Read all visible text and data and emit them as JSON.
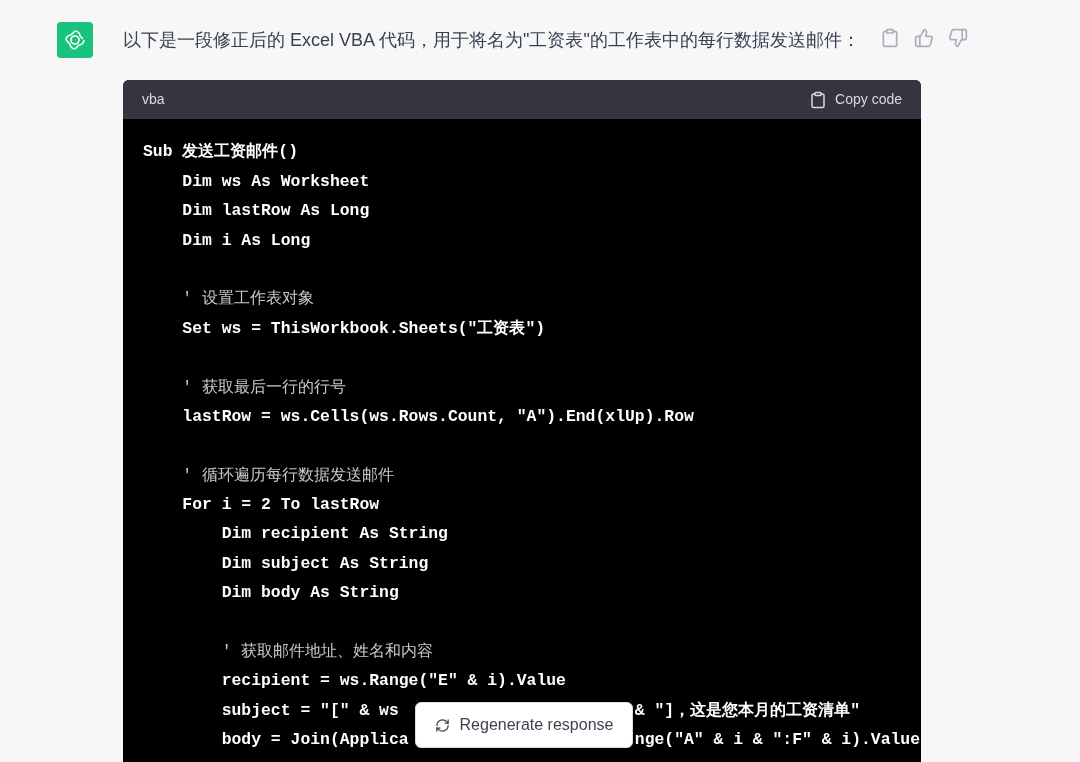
{
  "message": {
    "text": "以下是一段修正后的 Excel VBA 代码，用于将名为\"工资表\"的工作表中的每行数据发送邮件："
  },
  "code_block": {
    "language": "vba",
    "copy_label": "Copy code",
    "lines": [
      {
        "kind": "code",
        "text": "Sub 发送工资邮件()"
      },
      {
        "kind": "code",
        "text": "    Dim ws As Worksheet"
      },
      {
        "kind": "code",
        "text": "    Dim lastRow As Long"
      },
      {
        "kind": "code",
        "text": "    Dim i As Long"
      },
      {
        "kind": "blank"
      },
      {
        "kind": "comment",
        "text": "    ' 设置工作表对象"
      },
      {
        "kind": "code",
        "text": "    Set ws = ThisWorkbook.Sheets(\"工资表\")"
      },
      {
        "kind": "blank"
      },
      {
        "kind": "comment",
        "text": "    ' 获取最后一行的行号"
      },
      {
        "kind": "code",
        "text": "    lastRow = ws.Cells(ws.Rows.Count, \"A\").End(xlUp).Row"
      },
      {
        "kind": "blank"
      },
      {
        "kind": "comment",
        "text": "    ' 循环遍历每行数据发送邮件"
      },
      {
        "kind": "code",
        "text": "    For i = 2 To lastRow"
      },
      {
        "kind": "code",
        "text": "        Dim recipient As String"
      },
      {
        "kind": "code",
        "text": "        Dim subject As String"
      },
      {
        "kind": "code",
        "text": "        Dim body As String"
      },
      {
        "kind": "blank"
      },
      {
        "kind": "comment",
        "text": "        ' 获取邮件地址、姓名和内容"
      },
      {
        "kind": "code",
        "text": "        recipient = ws.Range(\"E\" & i).Value"
      },
      {
        "kind": "code",
        "text": "        subject = \"[\" & ws",
        "after": "& \"]，这是您本月的工资清单\""
      },
      {
        "kind": "code",
        "text": "        body = Join(Applica",
        "after": "nge(\"A\" & i & \":F\" & i).Value"
      }
    ]
  },
  "regenerate_button": {
    "label": "Regenerate response"
  }
}
